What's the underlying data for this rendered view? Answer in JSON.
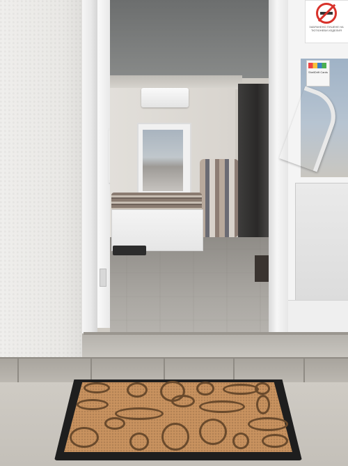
{
  "scene": {
    "description_items": [
      "left-wall",
      "open-doorway",
      "interior-room",
      "glass-door",
      "doormat"
    ]
  },
  "sign": {
    "caption": "ЗАБРАНЕНО ПУШЕНЕ НА ТЮТЮНЕВИ ИЗДЕЛИЯ"
  },
  "sticker": {
    "text": "ShellDrift Cards"
  },
  "colors": {
    "wall": "#ebeae7",
    "doormat_coir": "#c9935f",
    "doormat_border": "#1e1e1e",
    "sign_red": "#d8322b",
    "floor": "#a9a6a1"
  }
}
